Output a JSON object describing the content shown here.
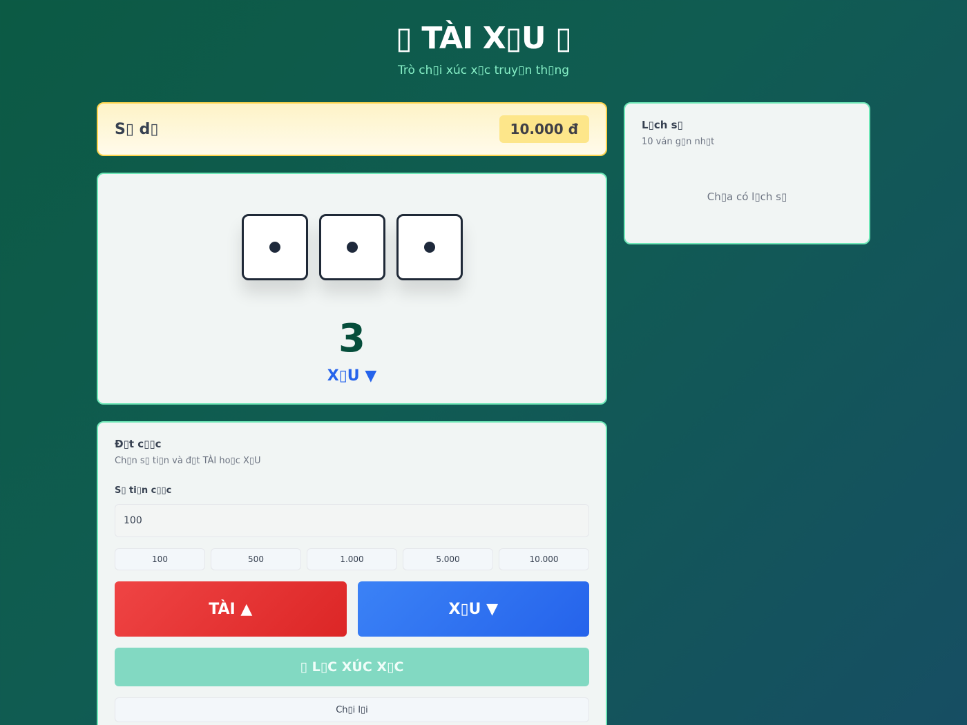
{
  "header": {
    "title": "▯ TÀI X▯U ▯",
    "subtitle": "Trò ch▯i xúc x▯c truy▯n th▯ng"
  },
  "balance": {
    "label": "S▯ d▯",
    "value": "10.000 đ"
  },
  "dice": {
    "values": [
      1,
      1,
      1
    ],
    "sum": "3",
    "result": "X▯U ▼"
  },
  "history": {
    "title": "L▯ch s▯",
    "subtitle": "10 ván g▯n nh▯t",
    "empty": "Ch▯a có l▯ch s▯"
  },
  "bet": {
    "title": "Đ▯t c▯▯c",
    "subtitle": "Ch▯n s▯ ti▯n và đ▯t TÀI ho▯c X▯U",
    "amount_label": "S▯ ti▯n c▯▯c",
    "amount_value": "100",
    "chips": [
      "100",
      "500",
      "1.000",
      "5.000",
      "10.000"
    ],
    "tai_label": "TÀI ▲",
    "xiu_label": "X▯U ▼",
    "shake_label": "▯ L▯C XÚC X▯C",
    "replay_label": "Ch▯i l▯i"
  },
  "colors": {
    "accent": "#6ee7b7",
    "tai": "#ef4444",
    "xiu": "#2563eb",
    "balance_bg": "#fef3c7"
  }
}
